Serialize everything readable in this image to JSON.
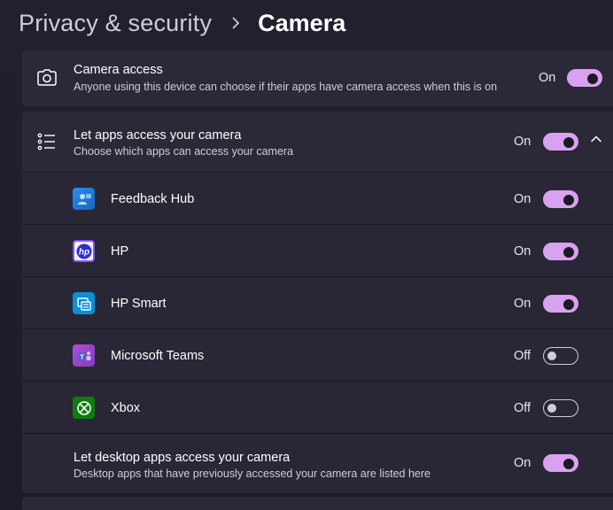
{
  "breadcrumb": {
    "parent": "Privacy & security",
    "separator_icon": "chevron-right-icon",
    "current": "Camera"
  },
  "camera_access": {
    "icon": "camera-icon",
    "title": "Camera access",
    "subtitle": "Anyone using this device can choose if their apps have camera access when this is on",
    "state": "On",
    "enabled": true
  },
  "let_apps": {
    "icon": "list-icon",
    "title": "Let apps access your camera",
    "subtitle": "Choose which apps can access your camera",
    "state": "On",
    "enabled": true,
    "expand_icon": "chevron-up-icon"
  },
  "apps": [
    {
      "name": "Feedback Hub",
      "icon": "feedback-hub-icon",
      "state": "On",
      "enabled": true
    },
    {
      "name": "HP",
      "icon": "hp-icon",
      "state": "On",
      "enabled": true
    },
    {
      "name": "HP Smart",
      "icon": "hp-smart-icon",
      "state": "On",
      "enabled": true
    },
    {
      "name": "Microsoft Teams",
      "icon": "microsoft-teams-icon",
      "state": "Off",
      "enabled": false
    },
    {
      "name": "Xbox",
      "icon": "xbox-icon",
      "state": "Off",
      "enabled": false
    }
  ],
  "desktop_apps": {
    "title": "Let desktop apps access your camera",
    "subtitle": "Desktop apps that have previously accessed your camera are listed here",
    "state": "On",
    "enabled": true
  },
  "colors": {
    "accent": "#d8a2ee",
    "background": "#1f1d2a",
    "card": "#2b2938"
  }
}
